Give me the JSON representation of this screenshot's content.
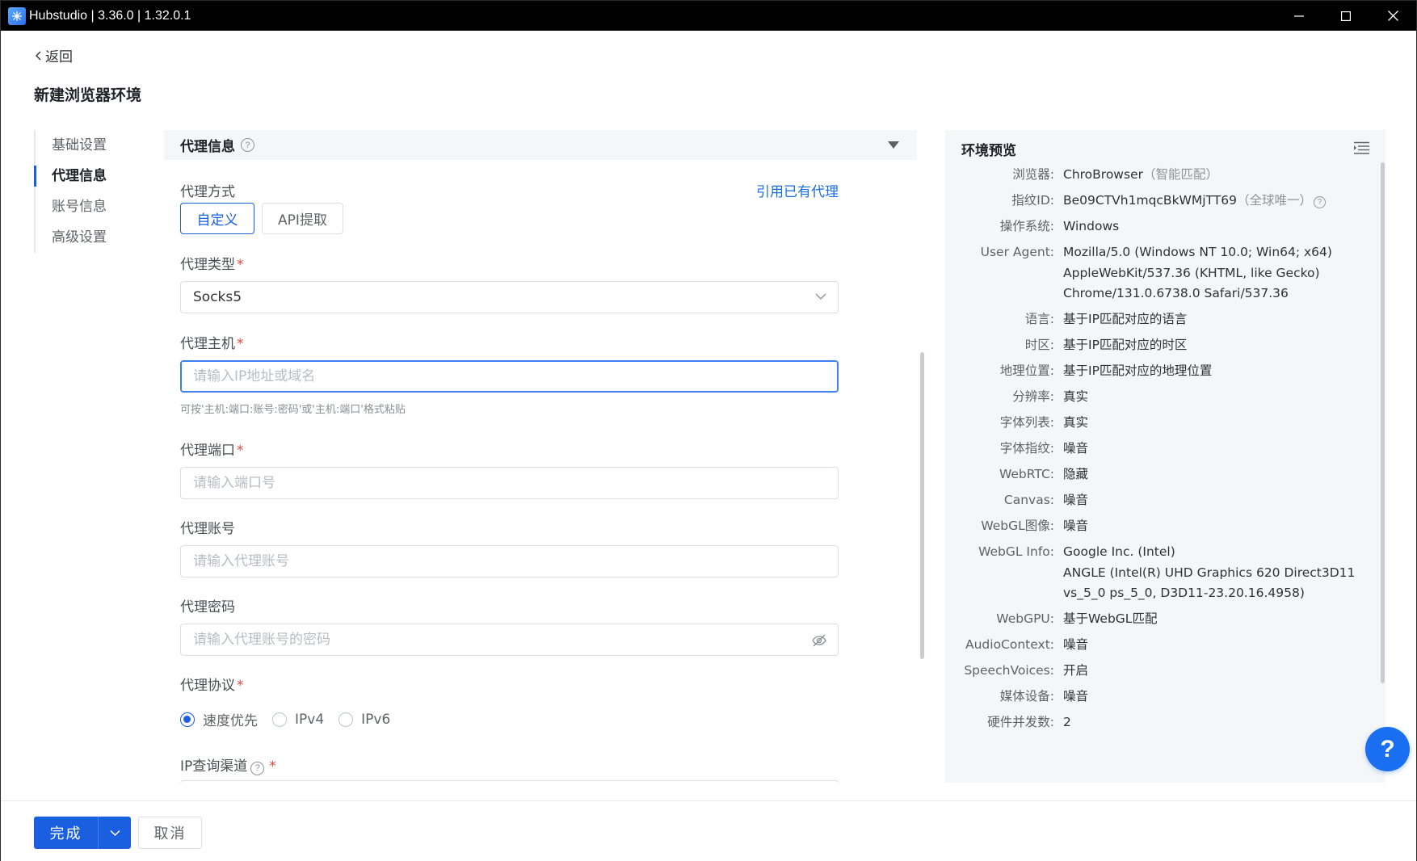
{
  "window": {
    "title": "Hubstudio | 3.36.0 | 1.32.0.1"
  },
  "header": {
    "back_label": "返回",
    "page_title": "新建浏览器环境"
  },
  "nav": {
    "items": [
      {
        "label": "基础设置"
      },
      {
        "label": "代理信息"
      },
      {
        "label": "账号信息"
      },
      {
        "label": "高级设置"
      }
    ],
    "active_index": 1
  },
  "proxy": {
    "section_title": "代理信息",
    "mode_label": "代理方式",
    "ref_existing": "引用已有代理",
    "mode_options": [
      "自定义",
      "API提取"
    ],
    "type_label": "代理类型",
    "type_value": "Socks5",
    "host_label": "代理主机",
    "host_placeholder": "请输入IP地址或域名",
    "host_hint": "可按'主机:端口:账号:密码'或'主机:端口'格式粘贴",
    "port_label": "代理端口",
    "port_placeholder": "请输入端口号",
    "account_label": "代理账号",
    "account_placeholder": "请输入代理账号",
    "password_label": "代理密码",
    "password_placeholder": "请输入代理账号的密码",
    "protocol_label": "代理协议",
    "protocol_options": [
      "速度优先",
      "IPv4",
      "IPv6"
    ],
    "protocol_selected": "速度优先",
    "ip_channel_label": "IP查询渠道"
  },
  "preview": {
    "title": "环境预览",
    "rows": [
      {
        "key": "浏览器:",
        "value": "ChroBrowser",
        "note": "（智能匹配）"
      },
      {
        "key": "指纹ID:",
        "value": "Be09CTVh1mqcBkWMjTT69",
        "note": "（全球唯一）"
      },
      {
        "key": "操作系统:",
        "value": "Windows"
      },
      {
        "key": "User Agent:",
        "lines": [
          "Mozilla/5.0 (Windows NT 10.0; Win64; x64)",
          "AppleWebKit/537.36 (KHTML, like Gecko)",
          "Chrome/131.0.6738.0 Safari/537.36"
        ]
      },
      {
        "key": "语言:",
        "value": "基于IP匹配对应的语言"
      },
      {
        "key": "时区:",
        "value": "基于IP匹配对应的时区"
      },
      {
        "key": "地理位置:",
        "value": "基于IP匹配对应的地理位置"
      },
      {
        "key": "分辨率:",
        "value": "真实"
      },
      {
        "key": "字体列表:",
        "value": "真实"
      },
      {
        "key": "字体指纹:",
        "value": "噪音"
      },
      {
        "key": "WebRTC:",
        "value": "隐藏"
      },
      {
        "key": "Canvas:",
        "value": "噪音"
      },
      {
        "key": "WebGL图像:",
        "value": "噪音"
      },
      {
        "key": "WebGL Info:",
        "lines": [
          "Google Inc. (Intel)",
          "ANGLE (Intel(R) UHD Graphics 620 Direct3D11",
          "vs_5_0 ps_5_0, D3D11-23.20.16.4958)"
        ]
      },
      {
        "key": "WebGPU:",
        "value": "基于WebGL匹配"
      },
      {
        "key": "AudioContext:",
        "value": "噪音"
      },
      {
        "key": "SpeechVoices:",
        "value": "开启"
      },
      {
        "key": "媒体设备:",
        "value": "噪音"
      },
      {
        "key": "硬件并发数:",
        "value": "2"
      }
    ]
  },
  "footer": {
    "done_label": "完成",
    "cancel_label": "取消"
  },
  "colors": {
    "primary": "#1a5fe0",
    "required": "#e0463c",
    "link": "#1a6fe0"
  }
}
